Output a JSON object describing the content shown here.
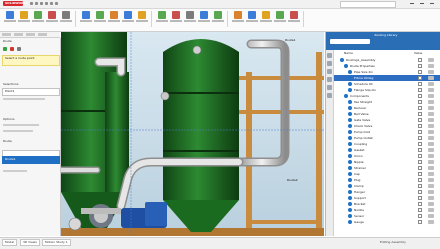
{
  "app": {
    "brand": "SOLIDWORKS",
    "window_title": "SOLIDWORKS Premium",
    "brand_color": "#d9262c",
    "accent_color": "#2a6fb6"
  },
  "ribbon": {
    "tabs": [
      "Assembly",
      "Layout",
      "Sketch",
      "Evaluate",
      "Routing",
      "Add-Ins"
    ],
    "buttons": [
      "open-icon",
      "save-icon",
      "print-icon",
      "undo-icon",
      "select-icon",
      "rebuild-icon",
      "options-icon",
      "insert-component-icon",
      "mate-icon",
      "pattern-icon",
      "smart-fastener-icon",
      "move-component-icon",
      "show-hidden-icon",
      "assembly-features-icon",
      "reference-geometry-icon",
      "bom-icon",
      "exploded-view-icon",
      "instant3d-icon",
      "route-properties-icon",
      "auto-route-icon"
    ]
  },
  "property_manager": {
    "title": "Route",
    "message": "Select a route point",
    "section_1_label": "Selections",
    "section_2_label": "Options",
    "selection_value": "Point1",
    "section_3_label": "Route",
    "selected_item": "Route1"
  },
  "viewport": {
    "annotation_right": "Route1",
    "annotation_bottom": "Route2",
    "tank_color": "#1d6a22",
    "frame_color": "#c98b3e",
    "pipe_color": "#d8d8d8",
    "pump_color": "#1f4fa3"
  },
  "task_pane": {
    "title": "Routing Library",
    "column_name": "Name",
    "column_value": "Value",
    "rows": [
      {
        "indent": 6,
        "ball": "#1e73c8",
        "label": "Routing1_Assembly",
        "selected": false
      },
      {
        "indent": 10,
        "ball": "#1e73c8",
        "label": "Route Properties",
        "selected": false
      },
      {
        "indent": 14,
        "ball": "#1e73c8",
        "label": "Pipe Size 2in",
        "selected": false
      },
      {
        "indent": 14,
        "ball": "#1e73c8",
        "label": "Elbow 90deg",
        "selected": true
      },
      {
        "indent": 14,
        "ball": "#1e73c8",
        "label": "Schedule 40",
        "selected": false
      },
      {
        "indent": 14,
        "ball": "#1e73c8",
        "label": "Flange Slip-On",
        "selected": false
      },
      {
        "indent": 10,
        "ball": "#1e73c8",
        "label": "Components",
        "selected": false
      },
      {
        "indent": 14,
        "ball": "#1e73c8",
        "label": "Tee Straight",
        "selected": false
      },
      {
        "indent": 14,
        "ball": "#1e73c8",
        "label": "Reducer",
        "selected": false
      },
      {
        "indent": 14,
        "ball": "#1e73c8",
        "label": "Ball Valve",
        "selected": false
      },
      {
        "indent": 14,
        "ball": "#1e73c8",
        "label": "Gate Valve",
        "selected": false
      },
      {
        "indent": 14,
        "ball": "#1e73c8",
        "label": "Check Valve",
        "selected": false
      },
      {
        "indent": 14,
        "ball": "#1e73c8",
        "label": "Pump Inlet",
        "selected": false
      },
      {
        "indent": 14,
        "ball": "#1e73c8",
        "label": "Pump Outlet",
        "selected": false
      },
      {
        "indent": 14,
        "ball": "#1e73c8",
        "label": "Coupling",
        "selected": false
      },
      {
        "indent": 14,
        "ball": "#1e73c8",
        "label": "Gasket",
        "selected": false
      },
      {
        "indent": 14,
        "ball": "#1e73c8",
        "label": "Union",
        "selected": false
      },
      {
        "indent": 14,
        "ball": "#1e73c8",
        "label": "Nipple",
        "selected": false
      },
      {
        "indent": 14,
        "ball": "#1e73c8",
        "label": "Strainer",
        "selected": false
      },
      {
        "indent": 14,
        "ball": "#1e73c8",
        "label": "Cap",
        "selected": false
      },
      {
        "indent": 14,
        "ball": "#1e73c8",
        "label": "Plug",
        "selected": false
      },
      {
        "indent": 14,
        "ball": "#1e73c8",
        "label": "Clamp",
        "selected": false
      },
      {
        "indent": 14,
        "ball": "#1e73c8",
        "label": "Hanger",
        "selected": false
      },
      {
        "indent": 14,
        "ball": "#1e73c8",
        "label": "Support",
        "selected": false
      },
      {
        "indent": 14,
        "ball": "#1e73c8",
        "label": "Bracket",
        "selected": false
      },
      {
        "indent": 14,
        "ball": "#1e73c8",
        "label": "Nozzle",
        "selected": false
      },
      {
        "indent": 14,
        "ball": "#1e73c8",
        "label": "Sensor",
        "selected": false
      },
      {
        "indent": 14,
        "ball": "#1e73c8",
        "label": "Gauge",
        "selected": false
      }
    ]
  },
  "status_bar": {
    "tabs": [
      "Model",
      "3D Views",
      "Motion Study 1"
    ],
    "message": "Editing Assembly"
  }
}
